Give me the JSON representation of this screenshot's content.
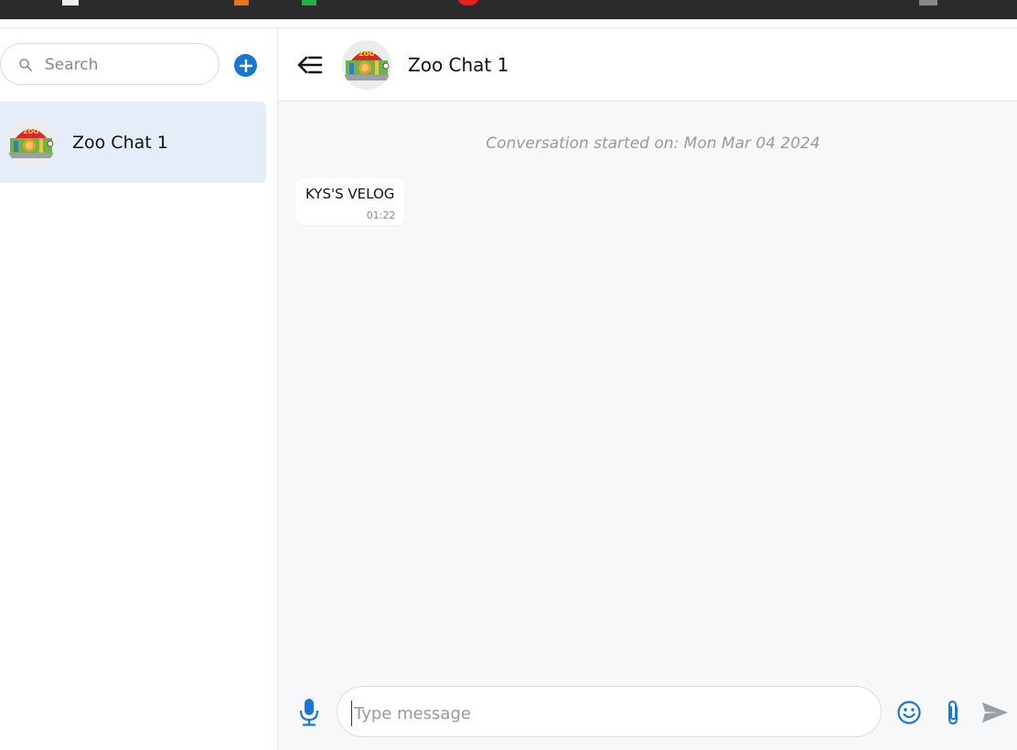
{
  "sidebar": {
    "search_placeholder": "Search",
    "conversations": [
      {
        "name": "Zoo Chat 1",
        "avatar": "zoo-avatar"
      }
    ]
  },
  "header": {
    "title": "Zoo Chat 1"
  },
  "messages": {
    "started_text": "Conversation started on: Mon Mar 04 2024",
    "items": [
      {
        "text": "KYS'S VELOG",
        "time": "01:22"
      }
    ]
  },
  "composer": {
    "placeholder": "Type message"
  },
  "colors": {
    "accent": "#1976d2",
    "selected_item_bg": "#e5eef8",
    "chat_bg": "#f7f8fa"
  },
  "icons": [
    "search-icon",
    "plus-icon",
    "back-arrow-icon",
    "microphone-icon",
    "emoji-icon",
    "paperclip-icon",
    "send-icon"
  ]
}
